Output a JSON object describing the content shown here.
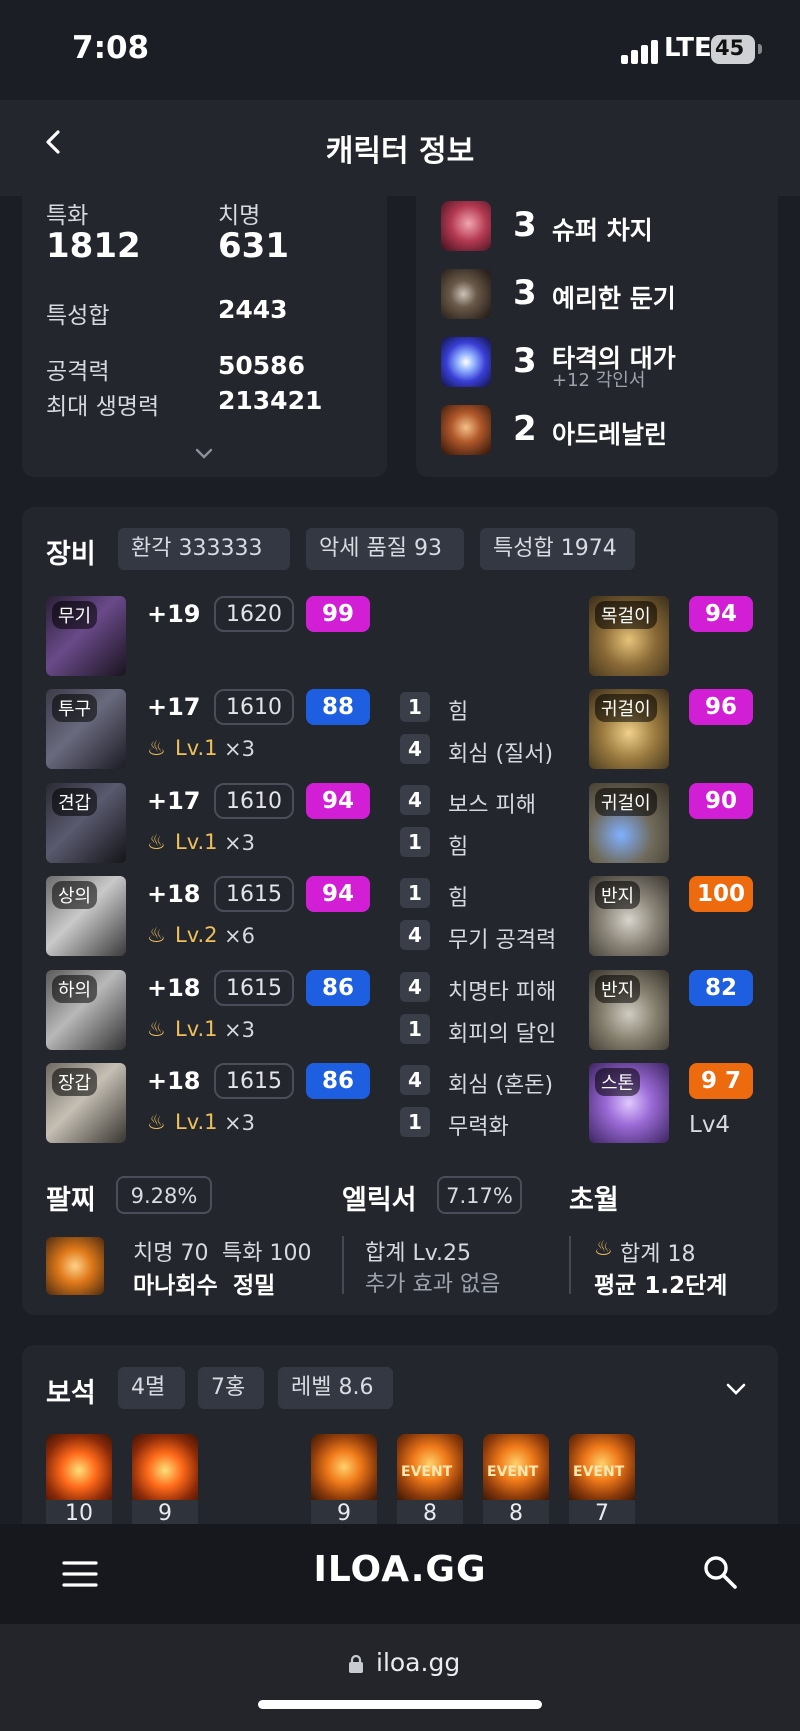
{
  "status_bar": {
    "time": "7:08",
    "network": "LTE",
    "battery": "45"
  },
  "header": {
    "title": "캐릭터 정보"
  },
  "stats": {
    "specialization": {
      "label": "특화",
      "value": "1812"
    },
    "crit": {
      "label": "치명",
      "value": "631"
    },
    "stat_total": {
      "label": "특성합",
      "value": "2443"
    },
    "attack": {
      "label": "공격력",
      "value": "50586"
    },
    "max_hp": {
      "label": "최대 생명력",
      "value": "213421"
    }
  },
  "engravings": [
    {
      "level": "3",
      "name": "슈퍼 차지",
      "sub": ""
    },
    {
      "level": "3",
      "name": "예리한 둔기",
      "sub": ""
    },
    {
      "level": "3",
      "name": "타격의 대가",
      "sub": "+12 각인서"
    },
    {
      "level": "2",
      "name": "아드레날린",
      "sub": ""
    }
  ],
  "equipment": {
    "title": "장비",
    "tags": [
      "환각 333333",
      "악세 품질 93",
      "특성합 1974"
    ],
    "gear": [
      {
        "slot": "무기",
        "enhance": "+19",
        "item_level": "1620",
        "quality": "99",
        "elixir_level": "",
        "elixir_mult": ""
      },
      {
        "slot": "투구",
        "enhance": "+17",
        "item_level": "1610",
        "quality": "88",
        "elixir_level": "Lv.1",
        "elixir_mult": "×3"
      },
      {
        "slot": "견갑",
        "enhance": "+17",
        "item_level": "1610",
        "quality": "94",
        "elixir_level": "Lv.1",
        "elixir_mult": "×3"
      },
      {
        "slot": "상의",
        "enhance": "+18",
        "item_level": "1615",
        "quality": "94",
        "elixir_level": "Lv.2",
        "elixir_mult": "×6"
      },
      {
        "slot": "하의",
        "enhance": "+18",
        "item_level": "1615",
        "quality": "86",
        "elixir_level": "Lv.1",
        "elixir_mult": "×3"
      },
      {
        "slot": "장갑",
        "enhance": "+18",
        "item_level": "1615",
        "quality": "86",
        "elixir_level": "Lv.1",
        "elixir_mult": "×3"
      }
    ],
    "effects": [
      {
        "n1": "1",
        "t1": "힘",
        "n2": "4",
        "t2": "회심 (질서)"
      },
      {
        "n1": "4",
        "t1": "보스 피해",
        "n2": "1",
        "t2": "힘"
      },
      {
        "n1": "1",
        "t1": "힘",
        "n2": "4",
        "t2": "무기 공격력"
      },
      {
        "n1": "4",
        "t1": "치명타 피해",
        "n2": "1",
        "t2": "회피의 달인"
      },
      {
        "n1": "4",
        "t1": "회심 (혼돈)",
        "n2": "1",
        "t2": "무력화"
      }
    ],
    "accessories": [
      {
        "slot": "목걸이",
        "quality": "94"
      },
      {
        "slot": "귀걸이",
        "quality": "96"
      },
      {
        "slot": "귀걸이",
        "quality": "90"
      },
      {
        "slot": "반지",
        "quality": "100"
      },
      {
        "slot": "반지",
        "quality": "82"
      },
      {
        "slot": "스톤",
        "quality": "9 7",
        "sub": "Lv4"
      }
    ]
  },
  "bracelet": {
    "label": "팔찌",
    "percent": "9.28%",
    "line1a": "치명 70",
    "line1b": "특화 100",
    "line2a": "마나회수",
    "line2b": "정밀"
  },
  "elixir": {
    "label": "엘릭서",
    "percent": "7.17%",
    "line1": "합계 Lv.25",
    "line2": "추가 효과 없음"
  },
  "transcend": {
    "label": "초월",
    "line1": "합계 18",
    "line2": "평균 1.2단계"
  },
  "gems": {
    "title": "보석",
    "tags": [
      "4멸",
      "7홍",
      "레벨 8.6"
    ],
    "items": [
      {
        "level": "10",
        "badge": ""
      },
      {
        "level": "9",
        "badge": ""
      },
      {
        "level": "9",
        "badge": ""
      },
      {
        "level": "8",
        "badge": "EVENT"
      },
      {
        "level": "8",
        "badge": "EVENT"
      },
      {
        "level": "7",
        "badge": "EVENT"
      }
    ]
  },
  "bottom_nav": {
    "logo": "ILOA.GG"
  },
  "url_bar": {
    "url": "iloa.gg"
  },
  "colors": {
    "background": "#1b1e24",
    "card": "#23262d",
    "quality_purple": "#d21fd6",
    "quality_blue": "#1d5fe0",
    "quality_orange": "#ee6a0e"
  }
}
